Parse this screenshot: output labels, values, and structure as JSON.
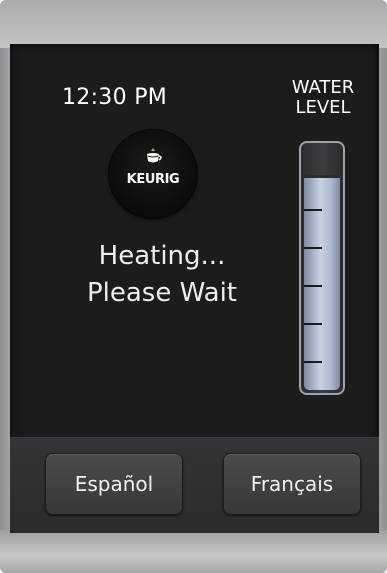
{
  "header": {
    "time": "12:30 PM"
  },
  "logo": {
    "text": "KEURIG"
  },
  "status": {
    "line1": "Heating...",
    "line2": "Please Wait"
  },
  "water_level": {
    "label_line1": "WATER",
    "label_line2": "LEVEL",
    "fill_fraction": 0.88
  },
  "language_buttons": {
    "spanish": "Español",
    "french": "Français"
  }
}
